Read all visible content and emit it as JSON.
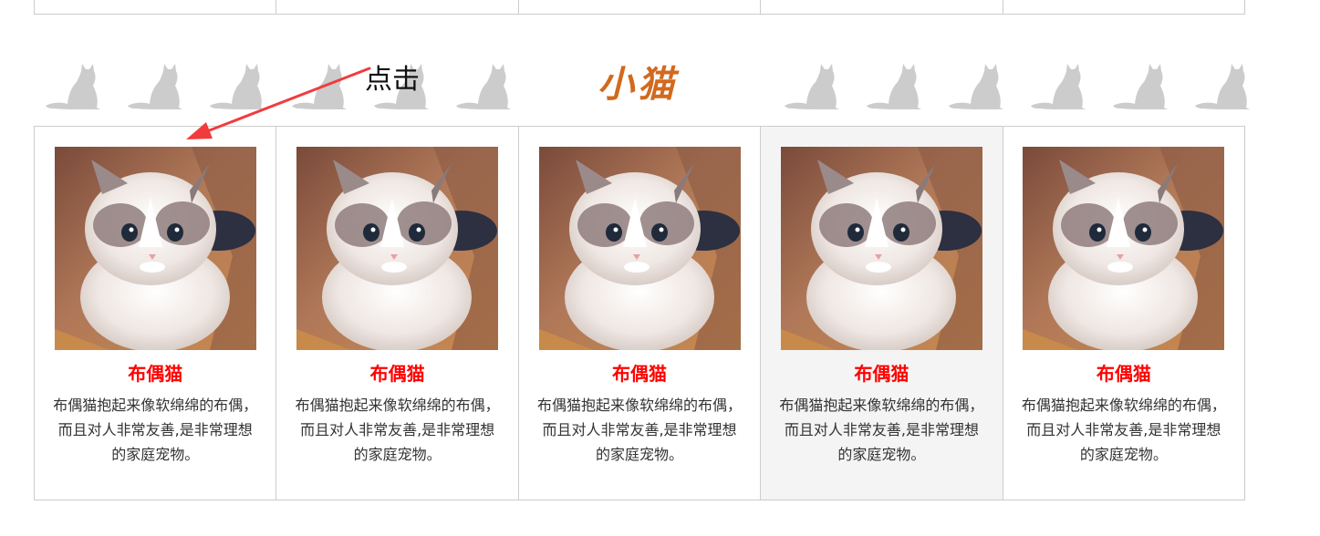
{
  "section": {
    "title": "小猫",
    "title_color": "#d2691e"
  },
  "annotation": {
    "label": "点击",
    "arrow_color": "#f03c3c"
  },
  "banner": {
    "icon": "cat-silhouette-icon",
    "color": "#cccccc"
  },
  "colors": {
    "name": "#ff0000",
    "border": "#cccccc",
    "hover_bg": "#f4f4f4"
  },
  "cards": [
    {
      "name": "布偶猫",
      "desc": "布偶猫抱起来像软绵绵的布偶，而且对人非常友善,是非常理想的家庭宠物。",
      "hovered": false
    },
    {
      "name": "布偶猫",
      "desc": "布偶猫抱起来像软绵绵的布偶，而且对人非常友善,是非常理想的家庭宠物。",
      "hovered": false
    },
    {
      "name": "布偶猫",
      "desc": "布偶猫抱起来像软绵绵的布偶，而且对人非常友善,是非常理想的家庭宠物。",
      "hovered": false
    },
    {
      "name": "布偶猫",
      "desc": "布偶猫抱起来像软绵绵的布偶，而且对人非常友善,是非常理想的家庭宠物。",
      "hovered": true
    },
    {
      "name": "布偶猫",
      "desc": "布偶猫抱起来像软绵绵的布偶，而且对人非常友善,是非常理想的家庭宠物。",
      "hovered": false
    }
  ]
}
